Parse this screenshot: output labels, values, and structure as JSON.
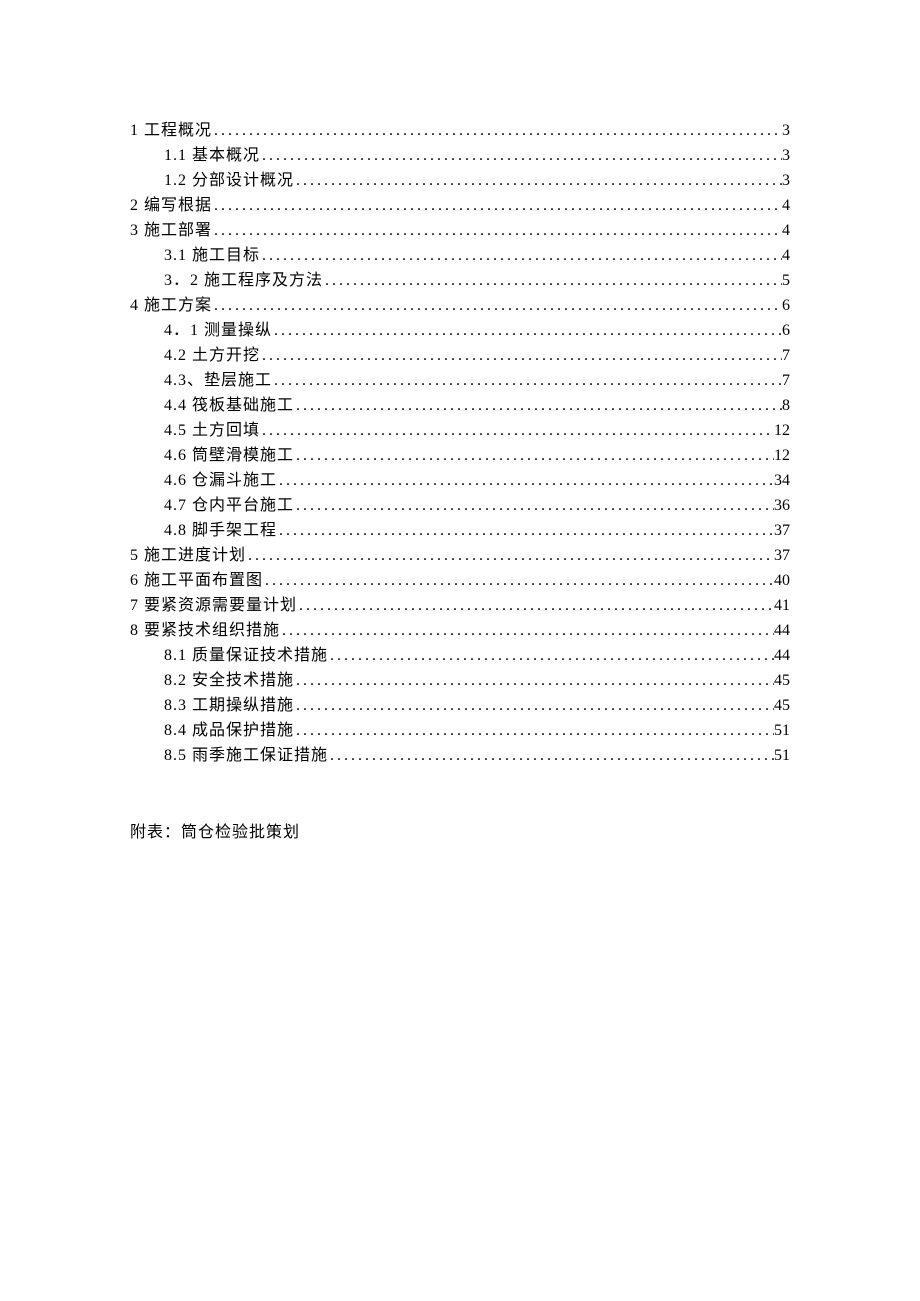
{
  "toc": [
    {
      "level": 1,
      "title": "1 工程概况",
      "page": "3"
    },
    {
      "level": 2,
      "title": "1.1 基本概况",
      "page": "3"
    },
    {
      "level": 2,
      "title": "1.2 分部设计概况",
      "page": "3"
    },
    {
      "level": 1,
      "title": "2 编写根据",
      "page": "4"
    },
    {
      "level": 1,
      "title": "3 施工部署",
      "page": "4"
    },
    {
      "level": 2,
      "title": "3.1 施工目标",
      "page": "4"
    },
    {
      "level": 2,
      "title": "3．2 施工程序及方法",
      "page": "5"
    },
    {
      "level": 1,
      "title": "4 施工方案",
      "page": "6"
    },
    {
      "level": 2,
      "title": "4．1 测量操纵",
      "page": "6"
    },
    {
      "level": 2,
      "title": "4.2 土方开挖",
      "page": "7"
    },
    {
      "level": 2,
      "title": "4.3、垫层施工",
      "page": "7"
    },
    {
      "level": 2,
      "title": "4.4 筏板基础施工",
      "page": "8"
    },
    {
      "level": 2,
      "title": "4.5 土方回填",
      "page": "12"
    },
    {
      "level": 2,
      "title": "4.6 筒壁滑模施工",
      "page": "12"
    },
    {
      "level": 2,
      "title": "4.6 仓漏斗施工",
      "page": "34"
    },
    {
      "level": 2,
      "title": "4.7 仓内平台施工",
      "page": "36"
    },
    {
      "level": 2,
      "title": "4.8 脚手架工程",
      "page": "37"
    },
    {
      "level": 1,
      "title": "5 施工进度计划",
      "page": "37"
    },
    {
      "level": 1,
      "title": "6 施工平面布置图",
      "page": "40"
    },
    {
      "level": 1,
      "title": "7 要紧资源需要量计划",
      "page": "41"
    },
    {
      "level": 1,
      "title": "8 要紧技术组织措施",
      "page": "44"
    },
    {
      "level": 2,
      "title": "8.1 质量保证技术措施",
      "page": "44"
    },
    {
      "level": 2,
      "title": "8.2 安全技术措施",
      "page": "45"
    },
    {
      "level": 2,
      "title": "8.3 工期操纵措施",
      "page": "45"
    },
    {
      "level": 2,
      "title": "8.4 成品保护措施",
      "page": "51"
    },
    {
      "level": 2,
      "title": "8.5 雨季施工保证措施",
      "page": "51"
    }
  ],
  "appendix": "附表：筒仓检验批策划"
}
